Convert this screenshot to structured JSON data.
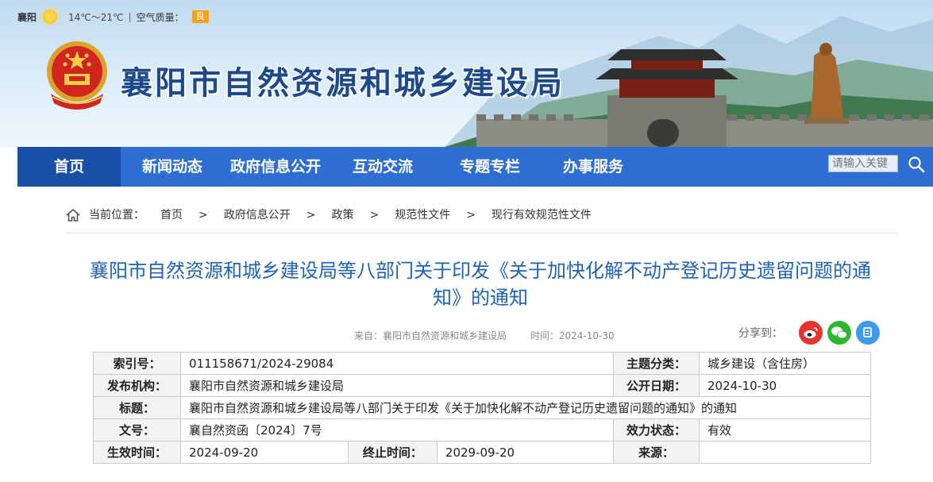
{
  "weather": {
    "city": "襄阳",
    "temperature": "14℃～21℃",
    "separator": "|",
    "aqi_label": "空气质量：",
    "aqi_value": "良"
  },
  "site": {
    "title": "襄阳市自然资源和城乡建设局"
  },
  "nav": {
    "items": [
      "首页",
      "新闻动态",
      "政府信息公开",
      "互动交流",
      "专题专栏",
      "办事服务"
    ],
    "search_placeholder": "请输入关键"
  },
  "breadcrumb": {
    "label": "当前位置：",
    "items": [
      "首页",
      "政府信息公开",
      "政策",
      "规范性文件",
      "现行有效规范性文件"
    ],
    "arrow": ">"
  },
  "article": {
    "title": "襄阳市自然资源和城乡建设局等八部门关于印发《关于加快化解不动产登记历史遗留问题的通知》的通知",
    "source": "来自：襄阳市自然资源和城乡建设局",
    "time": "时间：2024-10-30",
    "share_label": "分享到："
  },
  "info": {
    "index_label": "索引号：",
    "index_value": "011158671/2024-29084",
    "category_label": "主题分类：",
    "category_value": "城乡建设（含住房）",
    "issuer_label": "发布机构：",
    "issuer_value": "襄阳市自然资源和城乡建设局",
    "publish_label": "公开日期：",
    "publish_value": "2024-10-30",
    "title_label": "标题：",
    "title_value": "襄阳市自然资源和城乡建设局等八部门关于印发《关于加快化解不动产登记历史遗留问题的通知》的通知",
    "docno_label": "文号：",
    "docno_value": "襄自然资函〔2024〕7号",
    "status_label": "效力状态：",
    "status_value": "有效",
    "effective_label": "生效时间：",
    "effective_value": "2024-09-20",
    "expire_label": "终止时间：",
    "expire_value": "2029-09-20",
    "origin_label": "来源：",
    "origin_value": ""
  },
  "colors": {
    "nav": "#2e6ed2",
    "nav_active": "#1a4fa8",
    "title": "#1f63b8",
    "brand": "#1e4a8c"
  }
}
